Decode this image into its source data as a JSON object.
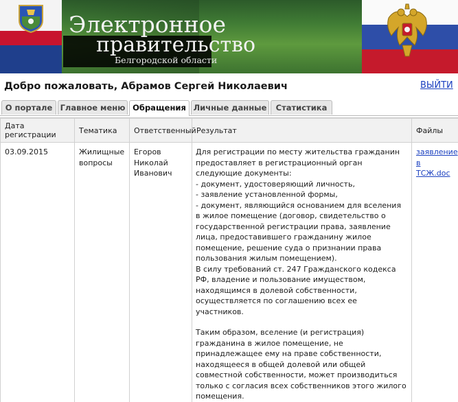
{
  "banner": {
    "title_line1": "Электронное",
    "title_line2": "правительство",
    "title_line3": "Белгородской области",
    "colors": {
      "flag_white": "#f4f4f4",
      "flag_blue": "#1f3f8c",
      "flag_red": "#c8142e",
      "grass": "#3f7a34"
    }
  },
  "header": {
    "welcome": "Добро пожаловать, Абрамов Сергей Николаевич",
    "logout": "ВЫЙТИ"
  },
  "tabs": [
    {
      "label": "О портале",
      "active": false
    },
    {
      "label": "Главное меню",
      "active": false
    },
    {
      "label": "Обращения",
      "active": true
    },
    {
      "label": "Личные данные",
      "active": false
    },
    {
      "label": "Статистика",
      "active": false
    }
  ],
  "table": {
    "columns": [
      "Дата регистрации",
      "Тематика",
      "Ответственный",
      "Результат",
      "Файлы"
    ],
    "rows": [
      {
        "date": "03.09.2015",
        "topic_line1": "Жилищные",
        "topic_line2": "вопросы",
        "responsible_line1": "Егоров",
        "responsible_line2": "Николай",
        "responsible_line3": "Иванович",
        "result_paragraphs": [
          "Для регистрации по месту жительства гражданин предоставляет в регистрационный орган следующие документы:",
          "- документ, удостоверяющий личность,",
          "- заявление установленной формы,",
          "- документ, являющийся основанием для вселения в жилое помещение (договор, свидетельство о государственной регистрации права, заявление лица, предоставившего гражданину жилое помещение, решение суда о признании права пользования жилым помещением).",
          "В силу требований ст. 247 Гражданского кодекса РФ, владение и пользование имуществом, находящимся в долевой собственности, осуществляется по соглашению всех ее участников.",
          "",
          "Таким образом, вселение (и регистрация) гражданина в жилое помещение, не принадлежащее ему на праве собственности, находящееся в общей долевой или общей совместной собственности, может производиться только с согласия всех собственников этого жилого помещения."
        ],
        "file_line1": "заявление",
        "file_line2": "в ТСЖ.doc"
      }
    ]
  }
}
